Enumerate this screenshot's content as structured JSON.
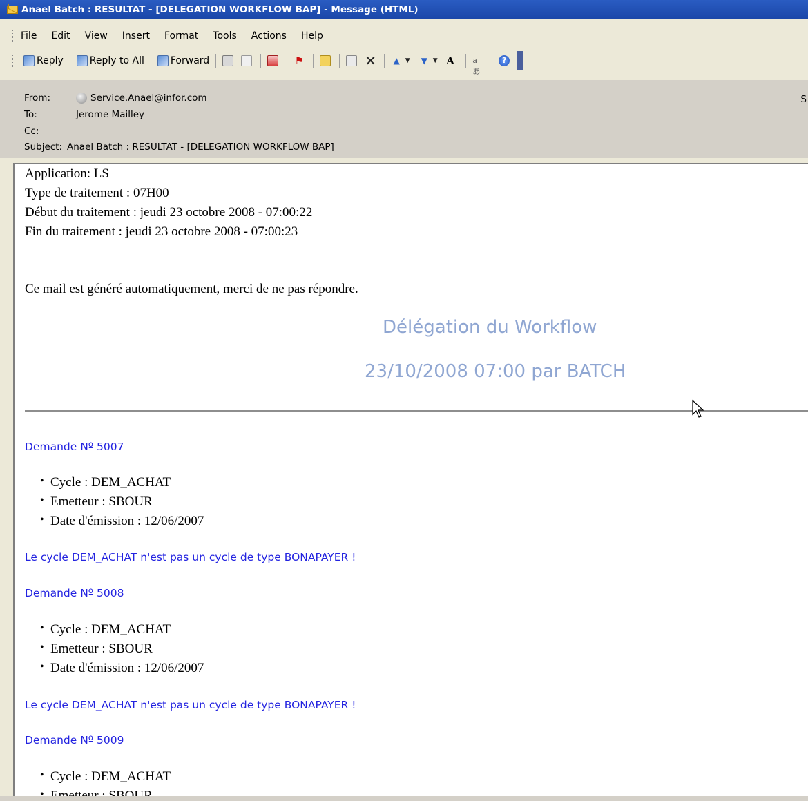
{
  "window": {
    "title": "Anael Batch : RESULTAT - [DELEGATION WORKFLOW BAP] - Message (HTML)"
  },
  "menu": [
    "File",
    "Edit",
    "View",
    "Insert",
    "Format",
    "Tools",
    "Actions",
    "Help"
  ],
  "toolbar": {
    "reply": "Reply",
    "reply_all": "Reply to All",
    "forward": "Forward"
  },
  "header": {
    "from_label": "From:",
    "from_value": "Service.Anael@infor.com",
    "to_label": "To:",
    "to_value": "Jerome Mailley",
    "cc_label": "Cc:",
    "subject_label": "Subject:",
    "subject_value": "Anael Batch : RESULTAT - [DELEGATION WORKFLOW BAP]",
    "edge": "S"
  },
  "body": {
    "application": "Application: LS",
    "type": "Type de traitement : 07H00",
    "debut": "Début du traitement : jeudi 23 octobre 2008 - 07:00:22",
    "fin": "Fin du traitement : jeudi 23 octobre 2008 - 07:00:23",
    "notice": "Ce mail est généré automatiquement, merci de ne pas répondre.",
    "heading": "Délégation du Workflow",
    "subheading": "23/10/2008 07:00 par BATCH",
    "demandes": [
      {
        "title": "Demande Nº 5007",
        "cycle": "Cycle : DEM_ACHAT",
        "emetteur": "Emetteur : SBOUR",
        "date": "Date d'émission : 12/06/2007",
        "message": "Le cycle DEM_ACHAT n'est pas un cycle de type BONAPAYER !"
      },
      {
        "title": "Demande Nº 5008",
        "cycle": "Cycle : DEM_ACHAT",
        "emetteur": "Emetteur : SBOUR",
        "date": "Date d'émission : 12/06/2007",
        "message": "Le cycle DEM_ACHAT n'est pas un cycle de type BONAPAYER !"
      },
      {
        "title": "Demande Nº 5009",
        "cycle": "Cycle : DEM_ACHAT",
        "emetteur": "Emetteur : SBOUR"
      }
    ]
  }
}
